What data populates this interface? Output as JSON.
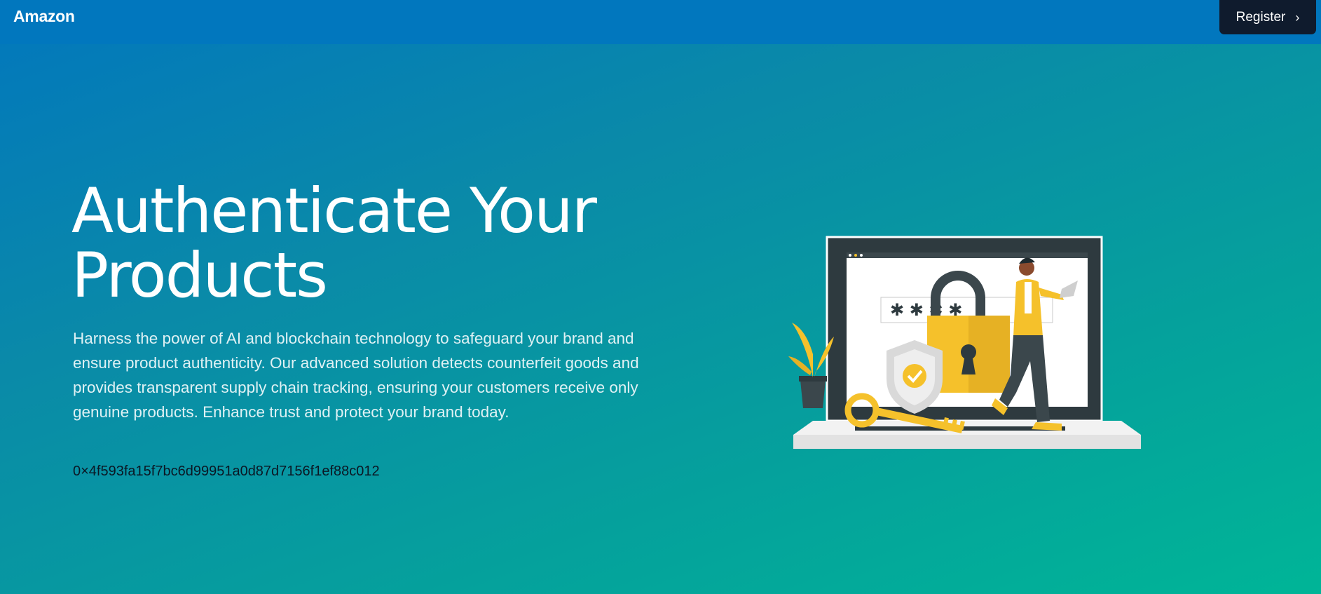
{
  "header": {
    "brand": "Amazon",
    "register_label": "Register"
  },
  "hero": {
    "title": "Authenticate Your Products",
    "description": "Harness the power of AI and blockchain technology to safeguard your brand and ensure product authenticity. Our advanced solution detects counterfeit goods and provides transparent supply chain tracking, ensuring your customers receive only genuine products. Enhance trust and protect your brand today.",
    "address": "0×4f593fa15f7bc6d99951a0d87d7156f1ef88c012"
  },
  "illustration": {
    "password_mask": "✱ ✱ ✱ ✱",
    "icons": [
      "laptop-icon",
      "padlock-icon",
      "shield-check-icon",
      "key-icon",
      "plant-icon",
      "person-icon"
    ]
  },
  "colors": {
    "header_bg": "#0177be",
    "register_bg": "#0f1b2d",
    "gradient_start": "#0277bd",
    "gradient_end": "#00b597",
    "accent_yellow": "#f5c12b"
  }
}
